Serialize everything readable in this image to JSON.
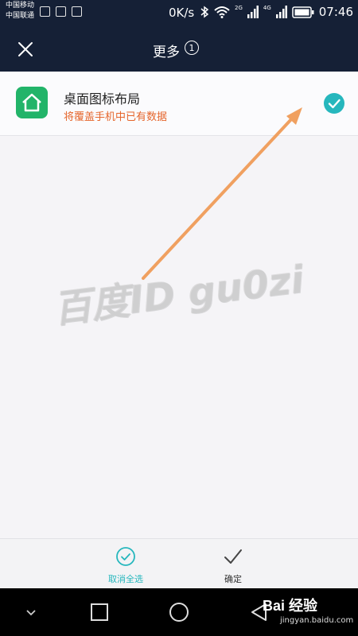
{
  "status_bar": {
    "carrier1": "中国移动",
    "carrier2": "中国联通",
    "net_speed": "0K/s",
    "net_2g": "2G",
    "net_4g": "4G",
    "time": "07:46"
  },
  "app_bar": {
    "title": "更多",
    "count_badge": "1"
  },
  "list": {
    "items": [
      {
        "title": "桌面图标布局",
        "subtitle": "将覆盖手机中已有数据",
        "checked": true
      }
    ]
  },
  "watermark": "百度ID gu0zi",
  "bottom_actions": {
    "deselect_label": "取消全选",
    "confirm_label": "确定"
  },
  "branding": {
    "brand": "Bai 经验",
    "url": "jingyan.baidu.com"
  },
  "colors": {
    "header_bg": "#152036",
    "accent_teal": "#26b7bd",
    "warning_orange": "#e5652b",
    "app_icon_green": "#22b469",
    "annotation_arrow": "#f0a060"
  }
}
